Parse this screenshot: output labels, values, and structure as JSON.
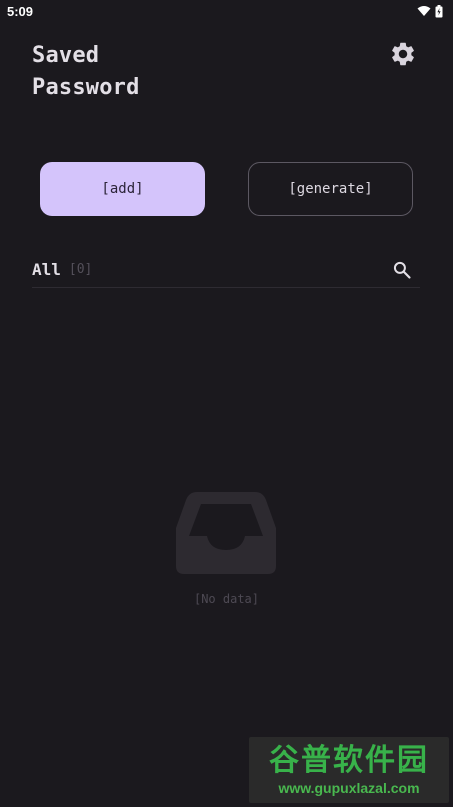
{
  "status_bar": {
    "time": "5:09"
  },
  "header": {
    "title_line1": "Saved",
    "title_line2": "Password",
    "settings_icon": "gear-icon"
  },
  "actions": {
    "add_label": "[add]",
    "generate_label": "[generate]"
  },
  "filter": {
    "label": "All",
    "count": "[0]",
    "search_icon": "search-icon"
  },
  "empty_state": {
    "icon": "inbox-tray-icon",
    "text": "[No data]"
  },
  "watermark": {
    "main": "谷普软件园",
    "url": "www.gupuxlazal.com"
  },
  "colors": {
    "background": "#1b191e",
    "accent": "#d4c4fb",
    "outline": "#5c5862",
    "text": "#e3dfe6",
    "muted": "#4d4953"
  }
}
